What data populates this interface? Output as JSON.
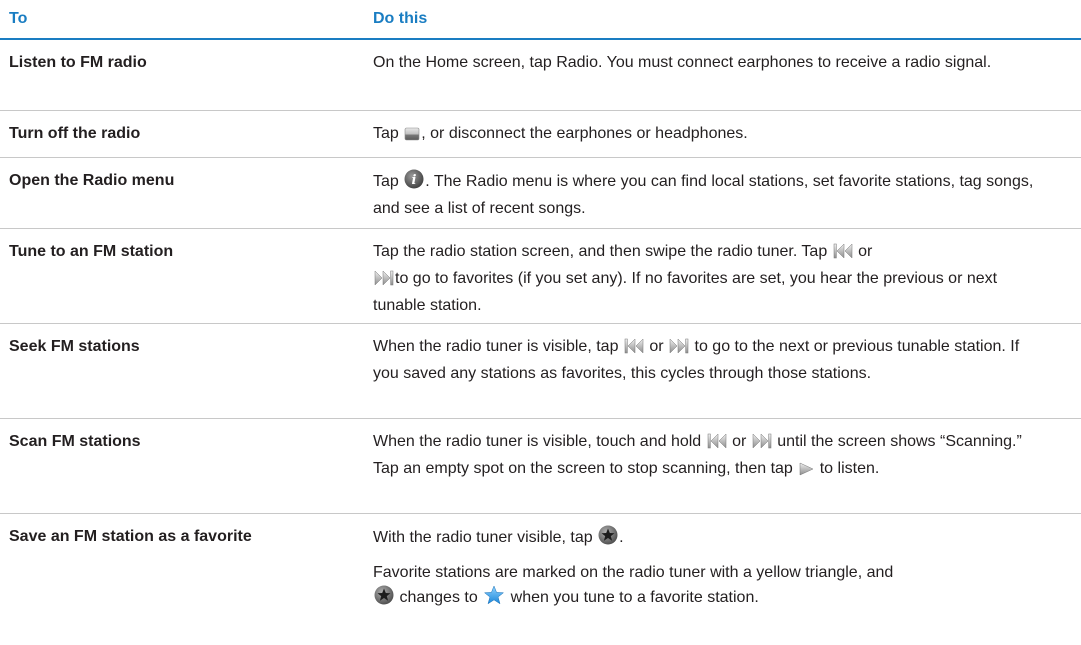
{
  "headers": {
    "to": "To",
    "do_this": "Do this"
  },
  "rows": [
    {
      "action": "Listen to FM radio",
      "desc": [
        "On the Home screen, tap Radio. You must connect earphones to receive a radio signal."
      ]
    },
    {
      "action": "Turn off the radio",
      "desc": [
        "Tap",
        ", or disconnect the earphones or headphones."
      ],
      "icons": [
        "stop-icon"
      ]
    },
    {
      "action": "Open the Radio menu",
      "desc": [
        "Tap",
        ". The Radio menu is where you can find local stations, set favorite stations, tag songs, and see a list of recent songs."
      ],
      "icons": [
        "info-icon"
      ]
    },
    {
      "action": "Tune to an FM station",
      "desc": [
        "Tap the radio station screen, and then swipe the radio tuner. Tap",
        "or",
        "to go to favorites (if you set any). If no favorites are set, you hear the previous or next tunable station."
      ],
      "icons": [
        "rewind-icon",
        "fast-forward-icon"
      ]
    },
    {
      "action": "Seek FM stations",
      "desc": [
        "When the radio tuner is visible, tap",
        "or",
        "to go to the next or previous tunable station. If you saved any stations as favorites, this cycles through those stations."
      ],
      "icons": [
        "rewind-icon",
        "fast-forward-icon"
      ]
    },
    {
      "action": "Scan FM stations",
      "desc": [
        "When the radio tuner is visible, touch and hold",
        "or",
        "until the screen shows “Scanning.” Tap an empty spot on the screen to stop scanning, then tap",
        "to listen."
      ],
      "icons": [
        "rewind-icon",
        "fast-forward-icon",
        "play-icon"
      ]
    },
    {
      "action": "Save an FM station as a favorite",
      "desc": [
        "With the radio tuner visible, tap",
        "."
      ],
      "desc2": [
        "Favorite stations are marked on the radio tuner with a yellow triangle, and",
        "changes to",
        "when you tune to a favorite station."
      ],
      "icons": [
        "favorite-star-icon"
      ],
      "icons2": [
        "favorite-star-icon",
        "blue-star-icon"
      ]
    }
  ],
  "colors": {
    "accent": "#1a7dc2",
    "rule": "#c8c8c8",
    "text": "#231f20"
  }
}
